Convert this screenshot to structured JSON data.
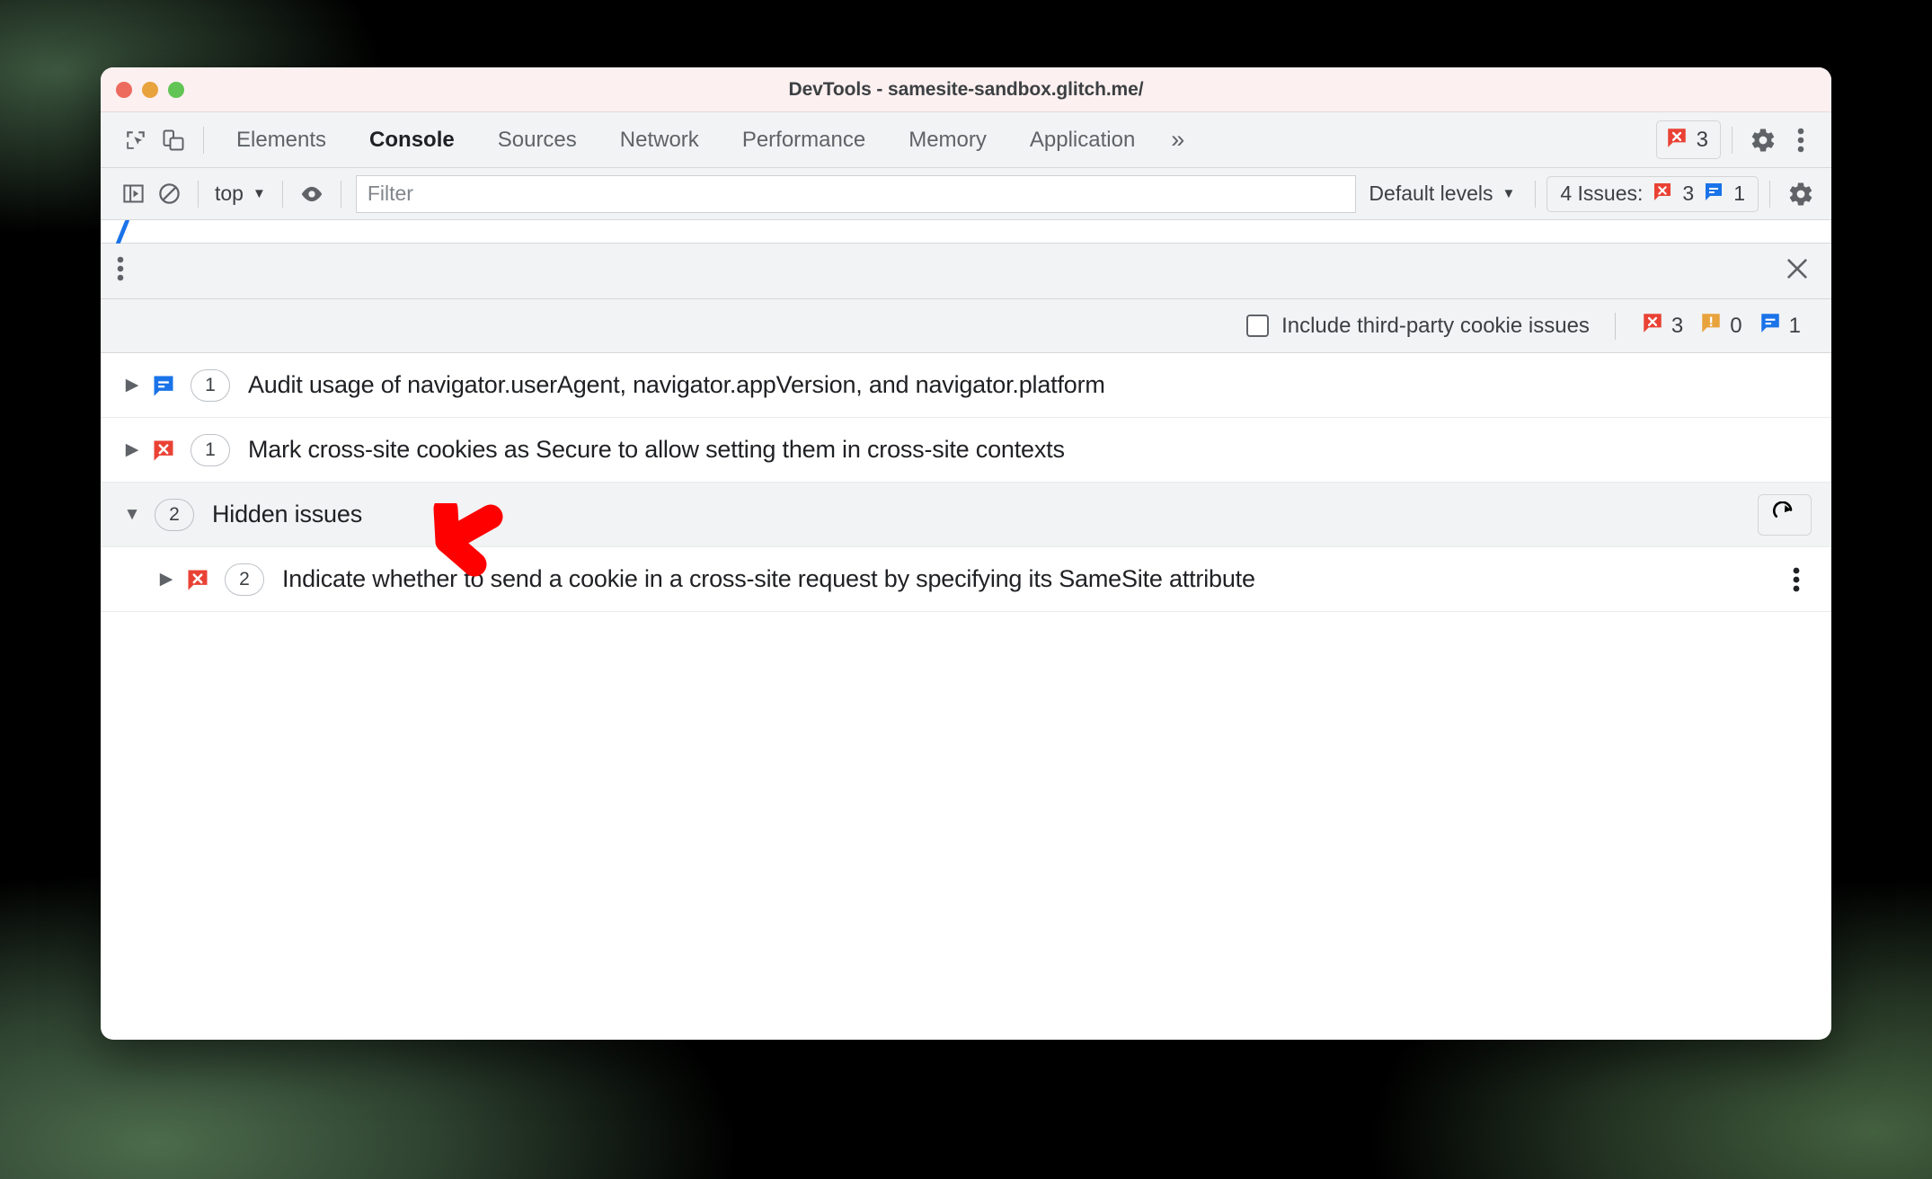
{
  "window": {
    "title": "DevTools - samesite-sandbox.glitch.me/",
    "traffic_lights": [
      "close",
      "minimize",
      "maximize"
    ]
  },
  "tabbar": {
    "inspect_icon": "inspect-element-icon",
    "device_icon": "device-toolbar-icon",
    "tabs": [
      {
        "label": "Elements",
        "active": false
      },
      {
        "label": "Console",
        "active": true
      },
      {
        "label": "Sources",
        "active": false
      },
      {
        "label": "Network",
        "active": false
      },
      {
        "label": "Performance",
        "active": false
      },
      {
        "label": "Memory",
        "active": false
      },
      {
        "label": "Application",
        "active": false
      }
    ],
    "more_tabs_label": "»",
    "error_count": "3",
    "error_icon": "error-badge-icon",
    "settings_icon": "gear-icon",
    "menu_icon": "kebab-menu-icon"
  },
  "filterbar": {
    "sidebar_toggle_icon": "console-sidebar-icon",
    "clear_console_icon": "clear-console-icon",
    "context": "top",
    "context_caret": "▼",
    "eye_icon": "live-expression-icon",
    "filter_placeholder": "Filter",
    "filter_value": "",
    "levels_label": "Default levels",
    "levels_caret": "▼",
    "issues_button": "4 Issues:",
    "issues_errors": "3",
    "issues_info": "1",
    "settings_icon": "gear-icon"
  },
  "drawer": {
    "menu_icon": "kebab-menu-icon",
    "close_icon": "close-icon",
    "include_third_party_label": "Include third-party cookie issues",
    "include_third_party_checked": false,
    "counts": {
      "errors": "3",
      "warnings": "0",
      "info": "1"
    }
  },
  "issues": [
    {
      "expander": "▶",
      "kind": "info",
      "count": "1",
      "text": "Audit usage of navigator.userAgent, navigator.appVersion, and navigator.platform",
      "group": false,
      "nested": false
    },
    {
      "expander": "▶",
      "kind": "error",
      "count": "1",
      "text": "Mark cross-site cookies as Secure to allow setting them in cross-site contexts",
      "group": false,
      "nested": false
    },
    {
      "expander": "▼",
      "kind": "none",
      "count": "2",
      "text": "Hidden issues",
      "group": true,
      "nested": false,
      "refresh_icon": "refresh-icon"
    },
    {
      "expander": "▶",
      "kind": "error",
      "count": "2",
      "text": "Indicate whether to send a cookie in a cross-site request by specifying its SameSite attribute",
      "group": false,
      "nested": true,
      "menu_icon": "kebab-menu-icon"
    }
  ],
  "annotation": {
    "arrow_icon": "red-pointer-arrow",
    "color": "#FF0000",
    "points_at": "Hidden issues"
  },
  "colors": {
    "error_red": "#e94235",
    "warning_orange": "#e8a33d",
    "info_blue": "#1a73e8",
    "titlebar_bg": "#fdf0f0",
    "chrome_bg": "#f1f3f4",
    "text": "#202124"
  }
}
